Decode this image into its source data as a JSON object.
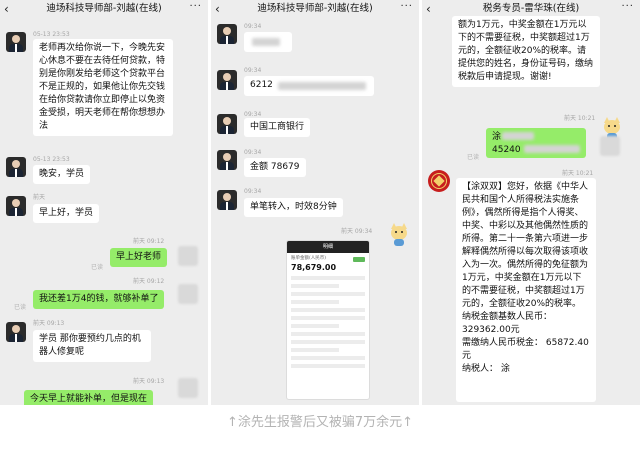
{
  "panel1": {
    "back": "‹",
    "title": "迪场科技导师部-刘越(在线)",
    "more": "···",
    "messages": [
      {
        "time": "05-13 23:53",
        "text": "老师再次给你说一下，今晚先安心休息不要在去待任何贷款，特别是你刚发给老师这个贷款平台不是正规的，如果他让你先交钱在给你贷款请你立即停止以免资金受损，明天老师在帮你想想办法"
      },
      {
        "time": "05-13 23:53",
        "text": "晚安，学员"
      },
      {
        "time": "前天",
        "text": "早上好，学员"
      },
      {
        "time": "前天 09:12",
        "text": "早上好老师",
        "status": "已读"
      },
      {
        "time": "前天 09:12",
        "text": "我还差1万4的钱，就够补单了",
        "status": "已读"
      },
      {
        "time": "前天 09:13",
        "text": "学员 那你要预约几点的机器人修复呢"
      },
      {
        "time": "前天 09:13",
        "text": "今天早上就能补单，但是现在"
      }
    ]
  },
  "panel2": {
    "back": "‹",
    "title": "迪场科技导师部-刘越(在线)",
    "more": "···",
    "messages": [
      {
        "time": "09:34",
        "text": ""
      },
      {
        "time": "09:34",
        "text": "6212"
      },
      {
        "time": "09:34",
        "text": "中国工商银行"
      },
      {
        "time": "09:34",
        "text": "金额 78679"
      },
      {
        "time": "09:34",
        "text": "单笔转入，时效8分钟"
      },
      {
        "time": "前天 09:34",
        "text": ""
      }
    ],
    "receipt": {
      "header": "明细",
      "label": "账单金额(人民币)",
      "amount": "78,679.00"
    }
  },
  "panel3": {
    "back": "‹",
    "title": "税务专员-雷华珠(在线)",
    "more": "···",
    "top_text": "额为1万元，中奖金额在1万元以下的不需要征税，中奖额超过1万元的，全额征收20%的税率。请提供您的姓名，身份证号码，缴纳税款后申请提现。谢谢!",
    "sticker_time": "前天 10:21",
    "sent_prefix": "涂",
    "sent_number": "45240",
    "sent_status": "已读",
    "reply_time": "前天 10:21",
    "reply_text": "【涂双双】您好，依据《中华人民共和国个人所得税法实施条例》，偶然所得是指个人得奖、中奖、中彩以及其他偶然性质的所得。第二十一条第六项进一步解释偶然所得以每次取得该项收入为一次。偶然所得的免征额为1万元，中奖金额在1万元以下的不需要征税，中奖额超过1万元的，全额征收20%的税率。",
    "line1": "纳税金额基数人民币：",
    "line2": "329362.00元",
    "line3": "需缴纳人民币税金：  65872.40元",
    "line4": "纳税人：  涂"
  },
  "caption": "↑涂先生报警后又被骗7万余元↑",
  "colors": {
    "chat_bg": "#ededed",
    "bubble_green": "#95ec69",
    "bubble_white": "#ffffff",
    "caption": "#b3b3b3"
  }
}
